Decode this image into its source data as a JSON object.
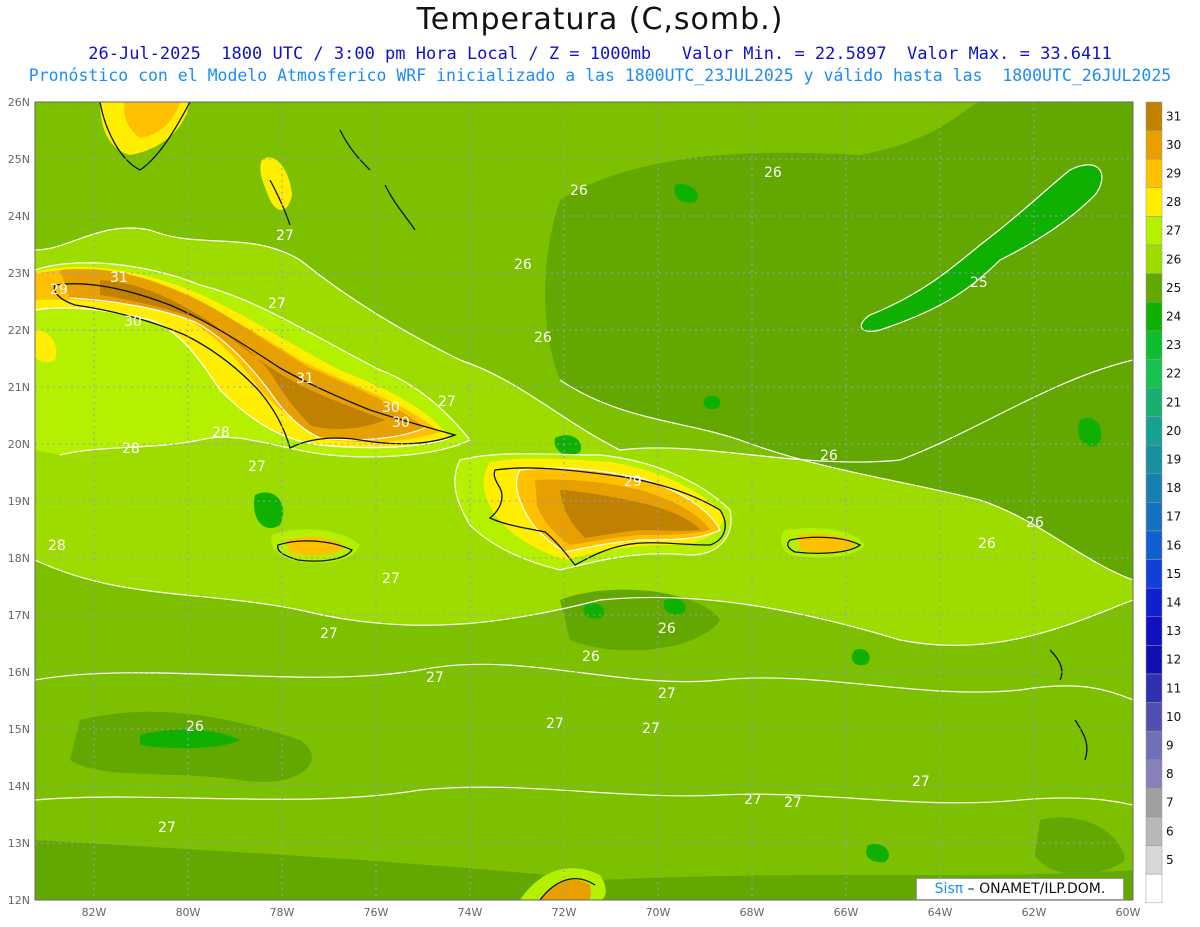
{
  "title": "Temperatura (C,somb.)",
  "subtitle_line1": "26-Jul-2025  1800 UTC / 3:00 pm Hora Local / Z = 1000mb   Valor Min. = 22.5897  Valor Max. = 33.6411",
  "subtitle_line2": "Pronóstico con el Modelo Atmosferico WRF inicializado a las 1800UTC_23JUL2025 y válido hasta las  1800UTC_26JUL2025",
  "credit": {
    "brand": "Sisπ",
    "text": " – ONAMET/ILP.DOM."
  },
  "colors": {
    "t25": "#62a800",
    "t26": "#7cc000",
    "t27": "#9edc00",
    "t28": "#b4f000",
    "t29": "#ffee00",
    "t30": "#ffc000",
    "t31": "#e8a000",
    "t32": "#c08000",
    "grid": "#9999dd",
    "coast": "#111111",
    "contour": "#ffffff"
  },
  "axes": {
    "lon_labels": [
      "82W",
      "80W",
      "78W",
      "76W",
      "74W",
      "72W",
      "70W",
      "68W",
      "66W",
      "64W",
      "62W",
      "60W"
    ],
    "lat_labels": [
      "26N",
      "25N",
      "24N",
      "23N",
      "22N",
      "21N",
      "20N",
      "19N",
      "18N",
      "17N",
      "16N",
      "15N",
      "14N",
      "13N",
      "12N"
    ]
  },
  "colorbar": [
    {
      "label": "31",
      "color": "#c08000"
    },
    {
      "label": "30",
      "color": "#e8a000"
    },
    {
      "label": "29",
      "color": "#ffc000"
    },
    {
      "label": "28",
      "color": "#ffee00"
    },
    {
      "label": "27",
      "color": "#b4f000"
    },
    {
      "label": "26",
      "color": "#9edc00"
    },
    {
      "label": "25",
      "color": "#62a800"
    },
    {
      "label": "24",
      "color": "#10b000"
    },
    {
      "label": "23",
      "color": "#10bc30"
    },
    {
      "label": "22",
      "color": "#18c050"
    },
    {
      "label": "21",
      "color": "#18b070"
    },
    {
      "label": "20",
      "color": "#18a090"
    },
    {
      "label": "19",
      "color": "#1890a0"
    },
    {
      "label": "18",
      "color": "#1880b0"
    },
    {
      "label": "17",
      "color": "#1870c0"
    },
    {
      "label": "16",
      "color": "#1060d0"
    },
    {
      "label": "15",
      "color": "#1040d8"
    },
    {
      "label": "14",
      "color": "#1020d0"
    },
    {
      "label": "13",
      "color": "#1010c0"
    },
    {
      "label": "12",
      "color": "#1010b0"
    },
    {
      "label": "11",
      "color": "#3030b0"
    },
    {
      "label": "10",
      "color": "#5050b0"
    },
    {
      "label": "9",
      "color": "#7070b8"
    },
    {
      "label": "8",
      "color": "#8880b8"
    },
    {
      "label": "7",
      "color": "#a0a0a0"
    },
    {
      "label": "6",
      "color": "#b8b8b8"
    },
    {
      "label": "5",
      "color": "#d8d8d8"
    },
    {
      "label": "",
      "color": "#ffffff"
    }
  ],
  "contour_labels": [
    "31",
    "30",
    "29",
    "31",
    "30",
    "30",
    "28",
    "28",
    "27",
    "27",
    "27",
    "26",
    "26",
    "26",
    "26",
    "26",
    "26",
    "25",
    "29",
    "27",
    "27",
    "27",
    "27",
    "27",
    "27",
    "27",
    "27",
    "27",
    "27",
    "26",
    "26",
    "26",
    "26",
    "28",
    "27"
  ]
}
